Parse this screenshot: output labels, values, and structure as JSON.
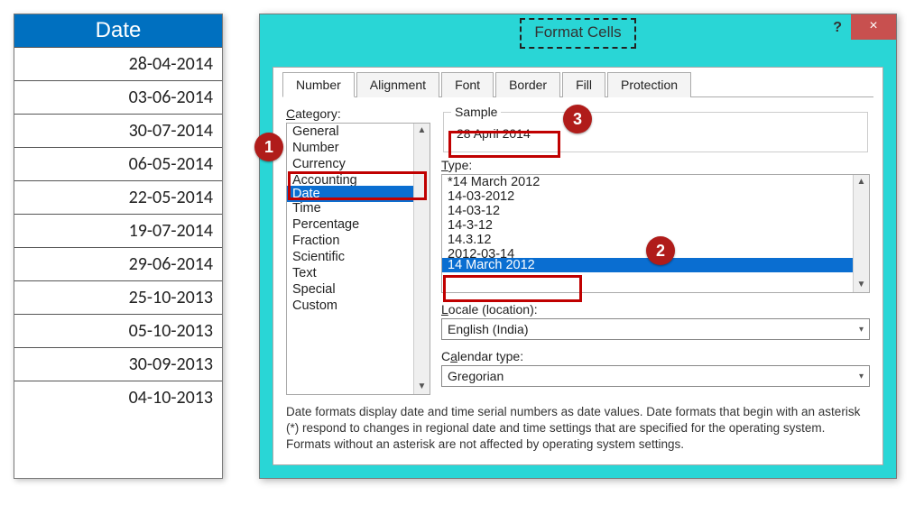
{
  "sheet": {
    "header": "Date",
    "rows": [
      "28-04-2014",
      "03-06-2014",
      "30-07-2014",
      "06-05-2014",
      "22-05-2014",
      "19-07-2014",
      "29-06-2014",
      "25-10-2013",
      "05-10-2013",
      "30-09-2013",
      "04-10-2013"
    ]
  },
  "dialog": {
    "title": "Format Cells",
    "help": "?",
    "close": "×",
    "tabs": [
      "Number",
      "Alignment",
      "Font",
      "Border",
      "Fill",
      "Protection"
    ],
    "activeTab": "Number",
    "categoryLabel": "Category:",
    "categories": [
      "General",
      "Number",
      "Currency",
      "Accounting",
      "Date",
      "Time",
      "Percentage",
      "Fraction",
      "Scientific",
      "Text",
      "Special",
      "Custom"
    ],
    "categorySelected": "Date",
    "sampleLabel": "Sample",
    "sampleValue": "28 April 2014",
    "typeLabel": "Type:",
    "types": [
      "*14 March 2012",
      "14-03-2012",
      "14-03-12",
      "14-3-12",
      "14.3.12",
      "2012-03-14",
      "14 March 2012"
    ],
    "typeSelected": "14 March 2012",
    "localeLabel": "Locale (location):",
    "localeValue": "English (India)",
    "calendarLabel": "Calendar type:",
    "calendarValue": "Gregorian",
    "info": "Date formats display date and time serial numbers as date values.  Date formats that begin with an asterisk (*) respond to changes in regional date and time settings that are specified for the operating system. Formats without an asterisk are not affected by operating system settings."
  },
  "callouts": {
    "b1": "1",
    "b2": "2",
    "b3": "3"
  }
}
